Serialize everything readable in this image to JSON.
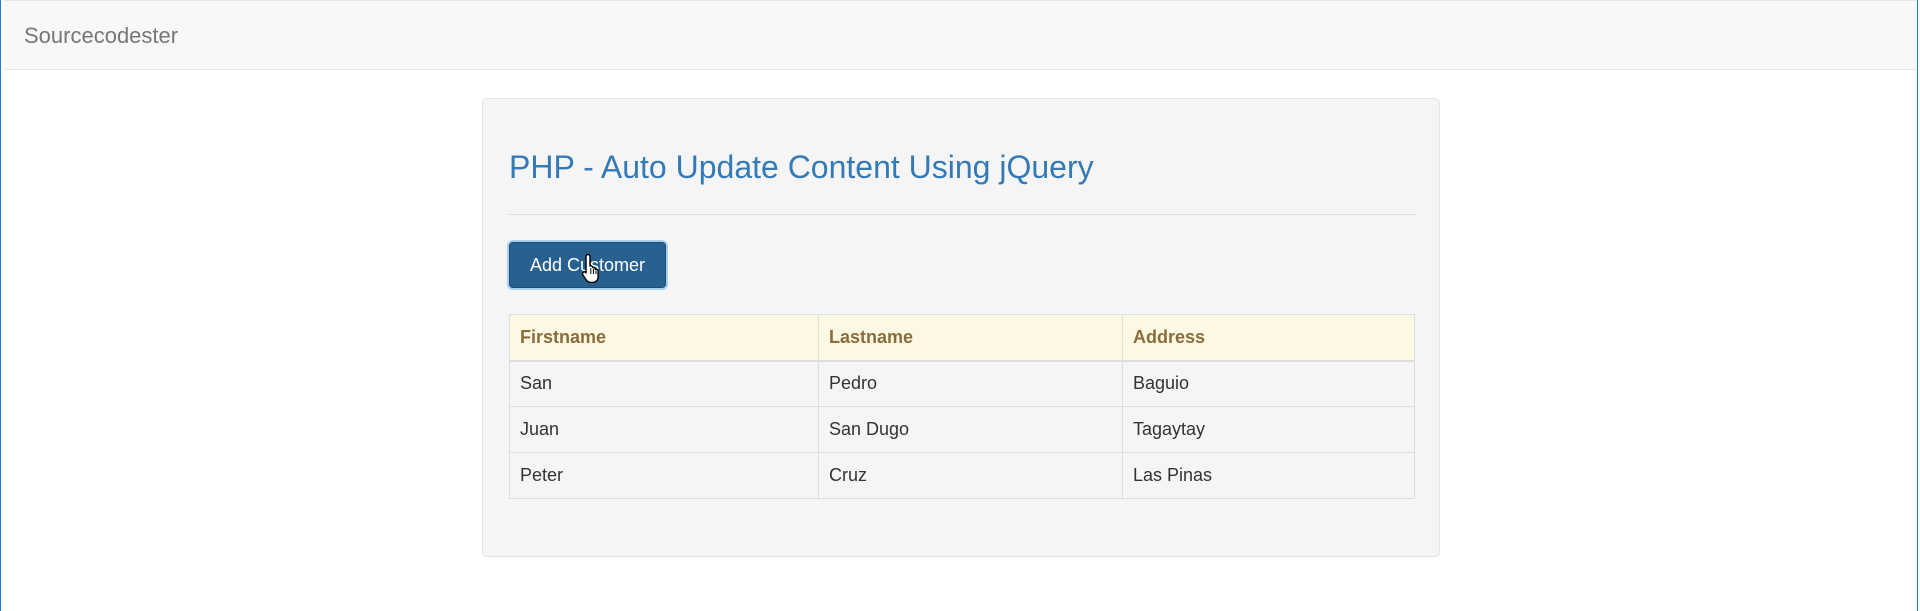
{
  "navbar": {
    "brand": "Sourcecodester"
  },
  "main": {
    "title": "PHP - Auto Update Content Using jQuery",
    "add_button_label": "Add Customer",
    "table": {
      "headers": [
        "Firstname",
        "Lastname",
        "Address"
      ],
      "rows": [
        [
          "San",
          "Pedro",
          "Baguio"
        ],
        [
          "Juan",
          "San Dugo",
          "Tagaytay"
        ],
        [
          "Peter",
          "Cruz",
          "Las Pinas"
        ]
      ]
    }
  },
  "colors": {
    "brand_text": "#777777",
    "title": "#337ab7",
    "button_bg": "#286090",
    "header_bg": "#fcf8e3",
    "header_text": "#8a6d3b"
  },
  "icons": {
    "cursor": "hand-pointer-cursor-icon"
  }
}
